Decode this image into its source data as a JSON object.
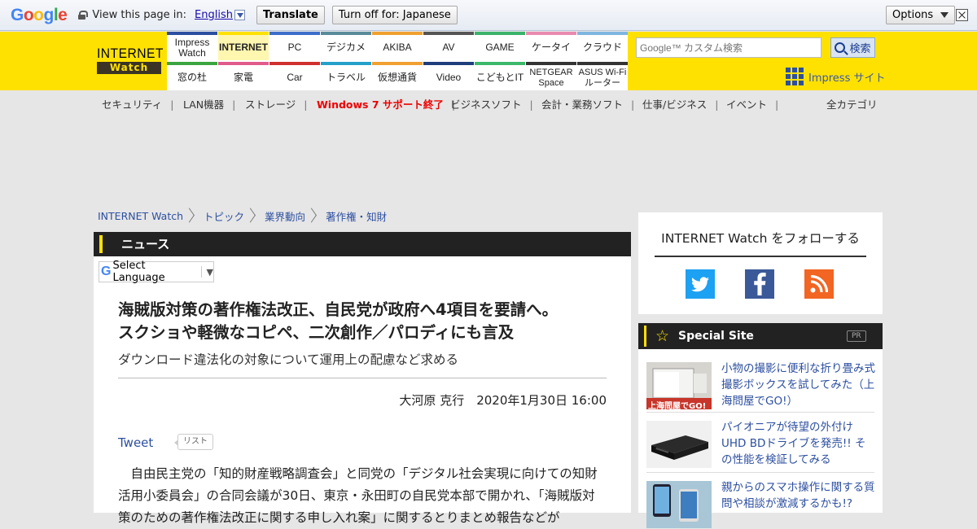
{
  "translate_bar": {
    "logo": "Google",
    "view_text": "View this page in:",
    "language": "English",
    "translate_label": "Translate",
    "turn_off_label": "Turn off for: Japanese",
    "options_label": "Options"
  },
  "header": {
    "logo_line1": "INTERNET",
    "logo_line2": "Watch",
    "nav_top": [
      {
        "label": "Impress Watch",
        "color": "#2d4fa0"
      },
      {
        "label": "INTERNET",
        "color": "#ffe100"
      },
      {
        "label": "PC",
        "color": "#3d6ec9"
      },
      {
        "label": "デジカメ",
        "color": "#5a8a9a"
      },
      {
        "label": "AKIBA",
        "color": "#f0a030"
      },
      {
        "label": "AV",
        "color": "#555555"
      },
      {
        "label": "GAME",
        "color": "#3bb36b"
      },
      {
        "label": "ケータイ",
        "color": "#e98ab0"
      },
      {
        "label": "クラウド",
        "color": "#7fb6e0"
      }
    ],
    "nav_bottom": [
      {
        "label": "窓の杜",
        "color": "#3aa540"
      },
      {
        "label": "家電",
        "color": "#e05a8a"
      },
      {
        "label": "Car",
        "color": "#d03030"
      },
      {
        "label": "トラベル",
        "color": "#25a0c8"
      },
      {
        "label": "仮想通貨",
        "color": "#f0a030"
      },
      {
        "label": "Video",
        "color": "#1e3d7a"
      },
      {
        "label": "こどもとIT",
        "color": "#3db86b"
      },
      {
        "label": "NETGEAR Space",
        "color": "#333333"
      },
      {
        "label": "ASUS Wi-Fiルーター",
        "color": "#333333"
      }
    ],
    "search_placeholder": "Google™ カスタム検索",
    "search_button": "検索",
    "impress_site": "Impress サイト"
  },
  "subnav": {
    "items": [
      "セキュリティ",
      "LAN機器",
      "ストレージ",
      "Windows 7 サポート終了",
      "ビジネスソフト",
      "会計・業務ソフト",
      "仕事/ビジネス",
      "イベント"
    ],
    "all_categories": "全カテゴリ"
  },
  "breadcrumb": [
    "INTERNET Watch",
    "トピック",
    "業界動向",
    "著作権・知財"
  ],
  "article": {
    "section": "ニュース",
    "language_select": "Select Language",
    "headline_line1": "海賊版対策の著作権法改正、自民党が政府へ4項目を要請へ。",
    "headline_line2": "スクショや軽微なコピペ、二次創作／パロディにも言及",
    "subheadline": "ダウンロード違法化の対象について運用上の配慮など求める",
    "byline": "大河原 克行　2020年1月30日 16:00",
    "tweet": "Tweet",
    "list": "リスト",
    "body": "自由民主党の「知的財産戦略調査会」と同党の「デジタル社会実現に向けての知財活用小委員会」の合同会議が30日、東京・永田町の自民党本部で開かれ、「海賊版対策のための著作権法改正に関する申し入れ案」に関するとりまとめ報告などが"
  },
  "sidebar": {
    "follow_title": "INTERNET Watch をフォローする",
    "special_title": "Special Site",
    "pr": "PR",
    "special_items": [
      {
        "text": "小物の撮影に便利な折り畳み式撮影ボックスを試してみた（上海問屋でGO!）",
        "thumb_caption": "上海問屋でGO!"
      },
      {
        "text": "パイオニアが待望の外付けUHD BDドライブを発売!! その性能を検証してみる",
        "thumb_caption": ""
      },
      {
        "text": "親からのスマホ操作に関する質問や相談が激減するかも!?",
        "thumb_caption": ""
      }
    ]
  }
}
